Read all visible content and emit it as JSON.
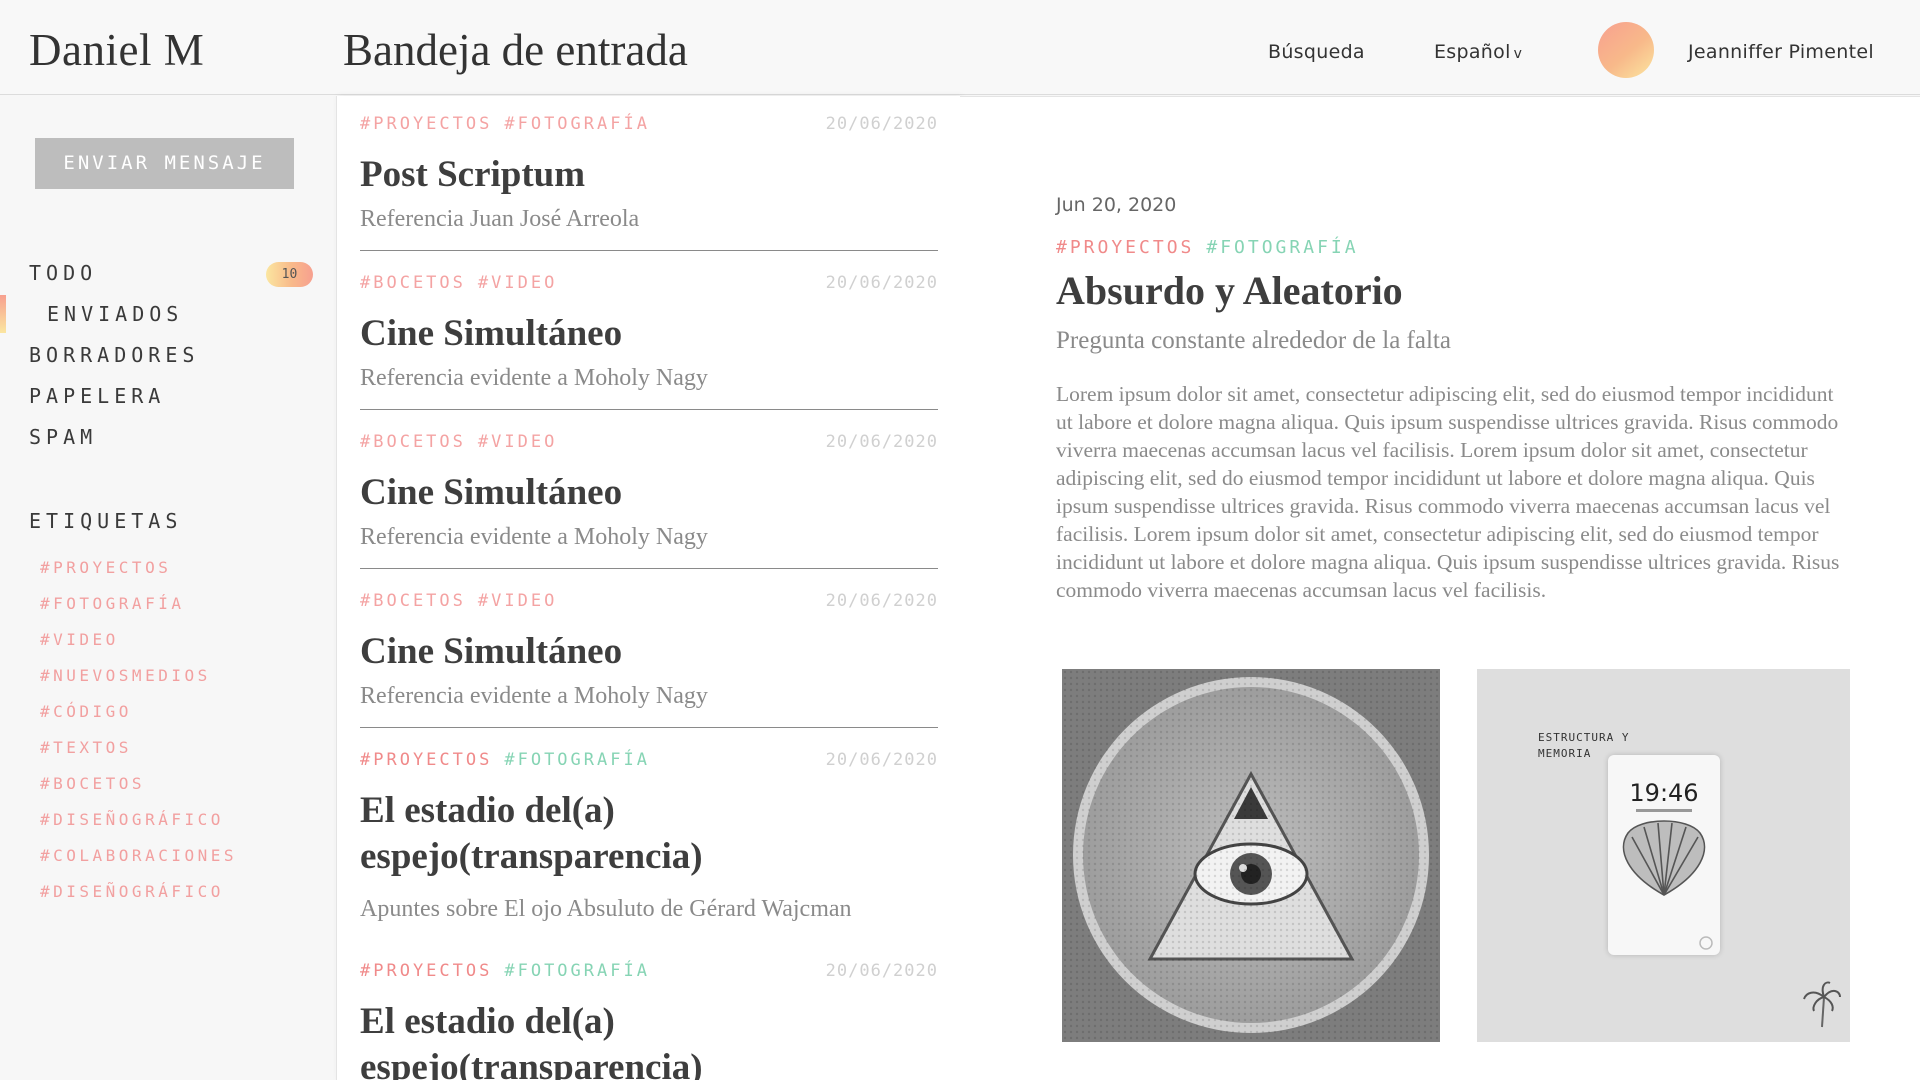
{
  "header": {
    "brand": "Daniel M",
    "page_title": "Bandeja de entrada",
    "search_label": "Búsqueda",
    "language_label": "Español",
    "language_chevron": "v",
    "user_name": "Jeanniffer Pimentel"
  },
  "sidebar": {
    "send_button": "ENVIAR MENSAJE",
    "folders": [
      {
        "label": "TODO",
        "count": "10"
      },
      {
        "label": "ENVIADOS"
      },
      {
        "label": "BORRADORES"
      },
      {
        "label": "PAPELERA"
      },
      {
        "label": "SPAM"
      }
    ],
    "tags_title": "ETIQUETAS",
    "tags": [
      "#PROYECTOS",
      "#FOTOGRAFÍA",
      "#VIDEO",
      "#NUEVOSMEDIOS",
      "#CÓDIGO",
      "#TEXTOS",
      "#BOCETOS",
      "#DISEÑOGRÁFICO",
      "#COLABORACIONES",
      "#DISEÑOGRÁFICO"
    ]
  },
  "messages": [
    {
      "tag1": "#PROYECTOS",
      "tag2": "#FOTOGRAFÍA",
      "date": "20/06/2020",
      "title": "Post Scriptum",
      "subtitle": "Referencia Juan José Arreola"
    },
    {
      "tag1": "#BOCETOS",
      "tag2": "#VIDEO",
      "date": "20/06/2020",
      "title": "Cine Simultáneo",
      "subtitle": "Referencia evidente a Moholy Nagy"
    },
    {
      "tag1": "#BOCETOS",
      "tag2": "#VIDEO",
      "date": "20/06/2020",
      "title": "Cine Simultáneo",
      "subtitle": "Referencia evidente a Moholy Nagy"
    },
    {
      "tag1": "#BOCETOS",
      "tag2": "#VIDEO",
      "date": "20/06/2020",
      "title": "Cine Simultáneo",
      "subtitle": "Referencia evidente a Moholy Nagy"
    },
    {
      "tag1": "#PROYECTOS",
      "tag2": "#FOTOGRAFÍA",
      "date": "20/06/2020",
      "title_line1": "El estadio del(a)",
      "title_line2": "espejo(transparencia)",
      "subtitle": "Apuntes sobre El ojo Absuluto de Gérard Wajcman"
    },
    {
      "tag1": "#PROYECTOS",
      "tag2": "#FOTOGRAFÍA",
      "date": "20/06/2020",
      "title_line1": "El estadio del(a)",
      "title_line2": "espejo(transparencia)"
    }
  ],
  "reader": {
    "date": "Jun 20, 2020",
    "tag1": "#PROYECTOS",
    "tag2": "#FOTOGRAFÍA",
    "title": "Absurdo y Aleatorio",
    "subtitle": "Pregunta constante alrededor de la falta",
    "body": "Lorem ipsum dolor sit amet, consectetur adipiscing elit, sed do eiusmod tempor incididunt ut labore et dolore magna aliqua. Quis ipsum suspendisse ultrices gravida. Risus commodo viverra maecenas accumsan lacus vel facilisis. Lorem ipsum dolor sit amet, consectetur adipiscing elit, sed do eiusmod tempor incididunt ut labore et dolore magna aliqua. Quis ipsum suspendisse ultrices gravida. Risus commodo viverra maecenas accumsan lacus vel facilisis. Lorem ipsum dolor sit amet, consectetur adipiscing elit, sed do eiusmod tempor incididunt ut labore et dolore magna aliqua. Quis ipsum suspendisse ultrices gravida. Risus commodo viverra maecenas accumsan lacus vel facilisis.",
    "image2_caption_line1": "ESTRUCTURA Y",
    "image2_caption_line2": "MEMORIA",
    "image2_phone_time": "19:46"
  },
  "colors": {
    "tag_pink": "#f4a3a3",
    "tag_green": "#86d4b4",
    "accent_gradient_start": "#f7a08f",
    "accent_gradient_end": "#fbe6a0"
  },
  "icons": {
    "language_chevron": "chevron-down-icon",
    "avatar": "avatar-gradient-circle"
  }
}
